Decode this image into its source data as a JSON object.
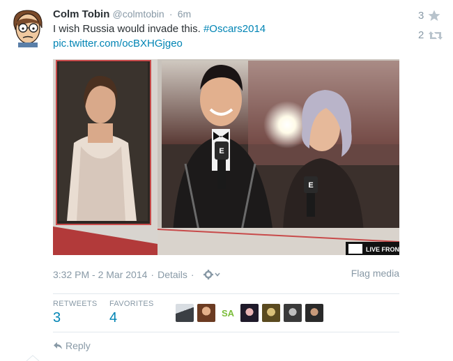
{
  "tweet": {
    "fullname": "Colm Tobin",
    "username": "@colmtobin",
    "time_sep": "·",
    "time": "6m",
    "text": "I wish Russia would invade this.",
    "hashtag": "#Oscars2014",
    "media_link": "pic.twitter.com/ocBXHGjgeo",
    "favorite_count": "3",
    "retweet_count": "2"
  },
  "media": {
    "tv_banner_text": "LIVE FRON",
    "mic_label": "E"
  },
  "meta": {
    "timestamp": "3:32 PM - 2 Mar 2014",
    "separator": "·",
    "details_label": "Details",
    "flag_label": "Flag media"
  },
  "stats": {
    "retweets_label": "RETWEETS",
    "retweets_value": "3",
    "favorites_label": "FAVORITES",
    "favorites_value": "4",
    "favoriter_badge_text": "SA"
  },
  "actions": {
    "reply_label": "Reply"
  },
  "colors": {
    "link": "#0084b4",
    "muted": "#8899a6",
    "divider": "#e1e8ed"
  }
}
